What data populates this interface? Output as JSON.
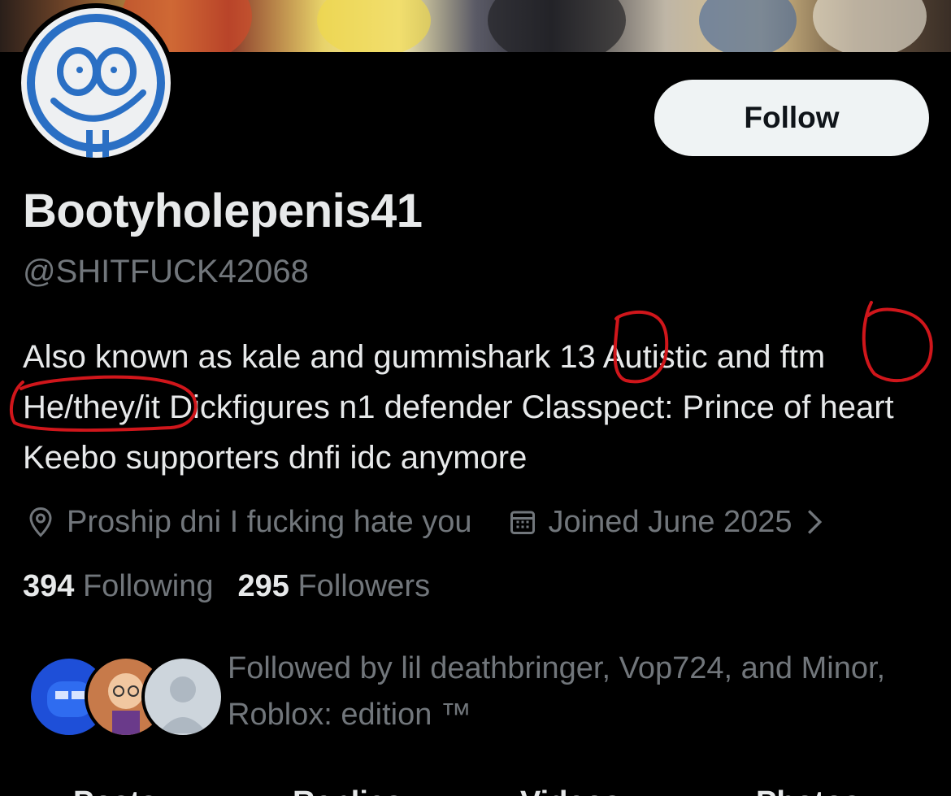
{
  "profile": {
    "display_name": "Bootyholepenis41",
    "handle": "@SHITFUCK42068",
    "bio_before_13": "Also known as kale and gummishark ",
    "bio_13": "13",
    "bio_middle": " Autistic and ",
    "bio_ftm": "ftm",
    "bio_pronouns": "He/they/it",
    "bio_after": " Dickfigures n1 defender Classpect: Prince of heart Keebo supporters dnfi idc anymore",
    "location": "Proship dni I fucking hate you",
    "joined": "Joined June 2025",
    "following_count": "394",
    "following_label": "Following",
    "followers_count": "295",
    "followers_label": "Followers",
    "followed_by_text": "Followed by lil deathbringer, Vop724, and Minor, Roblox: edition ™"
  },
  "actions": {
    "follow_label": "Follow"
  },
  "tabs": [
    "Posts",
    "Replies",
    "Videos",
    "Photos"
  ],
  "colors": {
    "background": "#000000",
    "primary_text": "#e7e9ea",
    "secondary_text": "#71767b",
    "follow_button_bg": "#eff3f4",
    "annotation_red": "#d0161b"
  },
  "icons": {
    "location": "location-pin-icon",
    "joined": "calendar-icon",
    "joined_more": "chevron-right-icon"
  }
}
